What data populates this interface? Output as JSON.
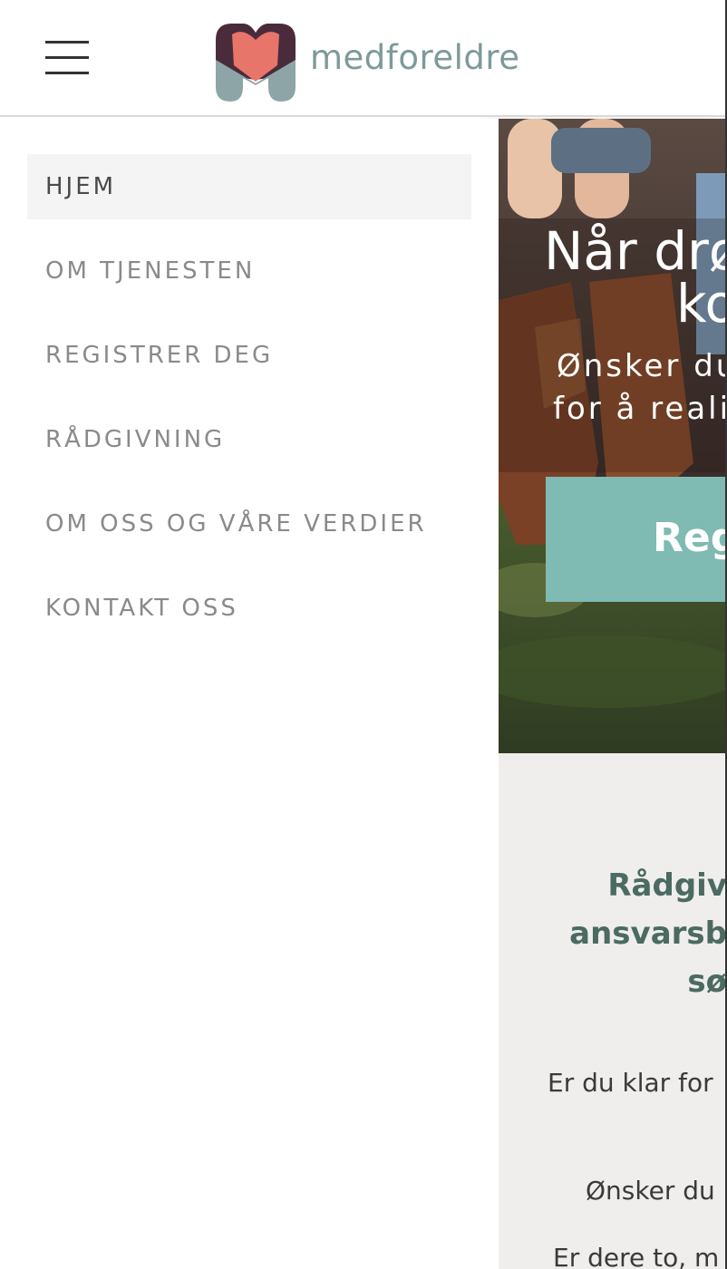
{
  "header": {
    "menu_icon": "hamburger-menu-icon",
    "logo_text": "medforeldre",
    "logo_icon": "medforeldre-heart-logo",
    "colors": {
      "logo_dark": "#4a2b3c",
      "logo_coral": "#e8756a",
      "logo_grey": "#8da5a6",
      "logo_text": "#7c9a99"
    }
  },
  "menu": {
    "items": [
      {
        "label": "HJEM",
        "active": true
      },
      {
        "label": "OM TJENESTEN"
      },
      {
        "label": "REGISTRER DEG"
      },
      {
        "label": "RÅDGIVNING"
      },
      {
        "label": "OM OSS OG VÅRE VERDIER"
      },
      {
        "label": "KONTAKT OSS"
      }
    ]
  },
  "hero": {
    "title_line1": "Når drø",
    "title_line2": "ko",
    "subtitle_line1": "Ønsker du",
    "subtitle_line2": "for å reali",
    "cta_label": "Reg",
    "colors": {
      "cta": "#7fbab3"
    }
  },
  "content": {
    "heading_line1": "Rådgiv",
    "heading_line2": "ansvarsb",
    "heading_line3": "sø",
    "paragraph1": "Er du klar for",
    "paragraph2": "Ønsker du",
    "paragraph3": "Er dere to, m",
    "colors": {
      "heading": "#4b6a62",
      "background": "#efeeed"
    }
  }
}
